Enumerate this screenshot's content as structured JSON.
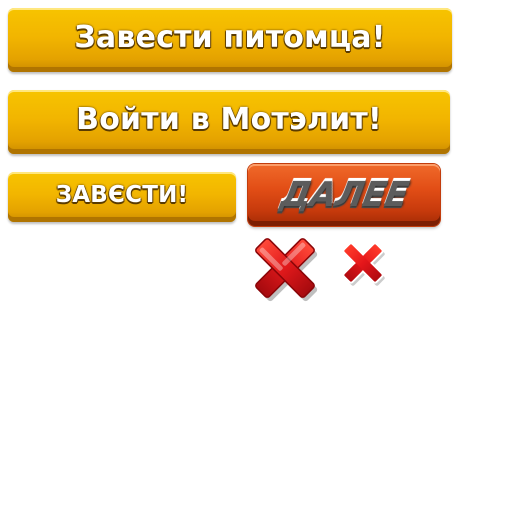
{
  "buttons": {
    "get_pet": "Завести питомца!",
    "login": "Войти в Мотэлит!",
    "start": "ЗАВЄСТИ!",
    "next": "ДАЛЕЕ"
  },
  "icons": {
    "close_large": "close-icon",
    "close_small": "close-icon"
  },
  "colors": {
    "yellow_button": "#f2b500",
    "red_button": "#e24e16",
    "close_red": "#e0191b"
  }
}
